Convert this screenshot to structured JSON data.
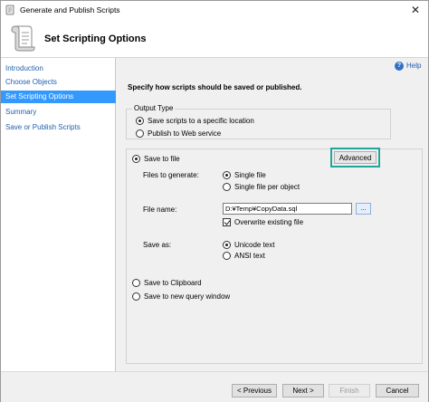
{
  "window": {
    "title": "Generate and Publish Scripts",
    "close_glyph": "✕"
  },
  "header": {
    "title": "Set Scripting Options"
  },
  "sidebar": {
    "items": [
      {
        "label": "Introduction"
      },
      {
        "label": "Choose Objects"
      },
      {
        "label": "Set Scripting Options",
        "selected": true
      },
      {
        "label": "Summary"
      },
      {
        "label": "Save or Publish Scripts"
      }
    ]
  },
  "main": {
    "help_label": "Help",
    "instructions": "Specify how scripts should be saved or published.",
    "output_type": {
      "legend": "Output Type",
      "options": [
        {
          "label": "Save scripts to a specific location",
          "checked": true
        },
        {
          "label": "Publish to Web service",
          "checked": false
        }
      ]
    },
    "save_to_file": {
      "label": "Save to file",
      "checked": true,
      "advanced_label": "Advanced",
      "files_to_generate_label": "Files to generate:",
      "files_options": [
        {
          "label": "Single file",
          "checked": true
        },
        {
          "label": "Single file per object",
          "checked": false
        }
      ],
      "file_name_label": "File name:",
      "file_name_value": "D:¥Temp¥CopyData.sql",
      "browse_label": "...",
      "overwrite_label": "Overwrite existing file",
      "overwrite_checked": true,
      "save_as_label": "Save as:",
      "save_as_options": [
        {
          "label": "Unicode text",
          "checked": true
        },
        {
          "label": "ANSI text",
          "checked": false
        }
      ]
    },
    "save_to_clipboard": {
      "label": "Save to Clipboard",
      "checked": false
    },
    "save_to_query_window": {
      "label": "Save to new query window",
      "checked": false
    }
  },
  "footer": {
    "previous_label": "< Previous",
    "next_label": "Next >",
    "finish_label": "Finish",
    "cancel_label": "Cancel"
  }
}
